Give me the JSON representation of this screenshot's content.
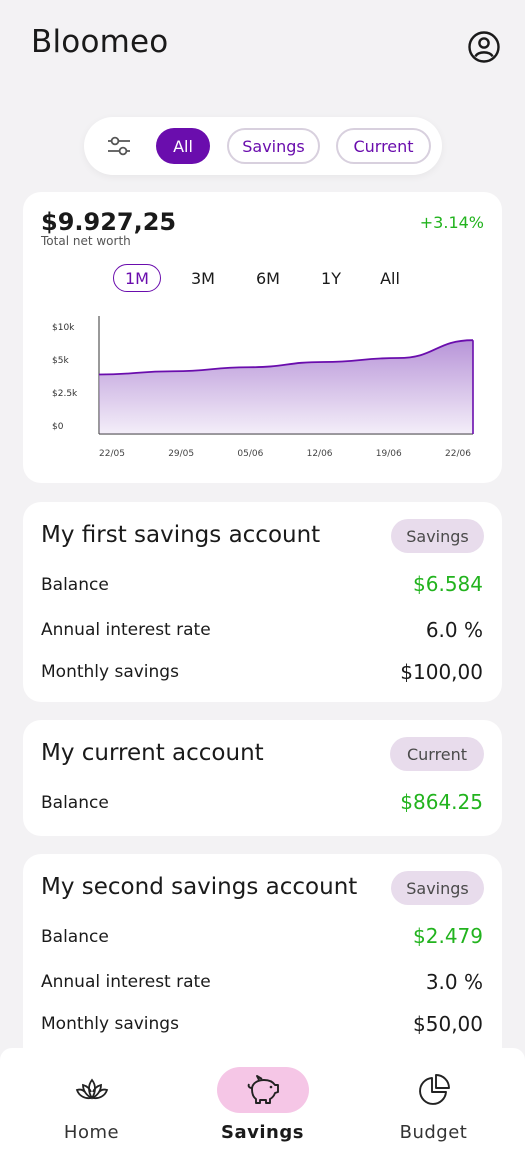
{
  "app": {
    "title": "Bloomeo"
  },
  "filters": {
    "all": "All",
    "savings": "Savings",
    "current": "Current",
    "selected": "All"
  },
  "networth": {
    "value": "$9.927,25",
    "label": "Total net worth",
    "change": "+3.14%",
    "ranges": [
      "1M",
      "3M",
      "6M",
      "1Y",
      "All"
    ],
    "selected_range": "1M"
  },
  "chart_data": {
    "type": "area",
    "x": [
      "22/05",
      "29/05",
      "05/06",
      "12/06",
      "19/06",
      "22/06"
    ],
    "x_ticks": [
      "22/05",
      "29/05",
      "05/06",
      "12/06",
      "19/06",
      "22/06"
    ],
    "y_ticks": [
      "$0",
      "$2.5k",
      "$5k",
      "$10k"
    ],
    "series": [
      {
        "values": [
          3900,
          4150,
          4450,
          4850,
          5300,
          8000
        ]
      }
    ],
    "line_color": "#6a0dad",
    "fill_color": "#b48fd6",
    "grid": false,
    "legend": "none"
  },
  "accounts": [
    {
      "name": "My first savings account",
      "badge": "Savings",
      "rows": [
        {
          "label": "Balance",
          "value": "$6.584",
          "green": true
        },
        {
          "label": "Annual interest rate",
          "value": "6.0 %",
          "green": false
        },
        {
          "label": "Monthly savings",
          "value": "$100,00",
          "green": false
        }
      ]
    },
    {
      "name": "My current account",
      "badge": "Current",
      "rows": [
        {
          "label": "Balance",
          "value": "$864.25",
          "green": true
        }
      ]
    },
    {
      "name": "My second savings account",
      "badge": "Savings",
      "rows": [
        {
          "label": "Balance",
          "value": "$2.479",
          "green": true
        },
        {
          "label": "Annual interest rate",
          "value": "3.0 %",
          "green": false
        },
        {
          "label": "Monthly savings",
          "value": "$50,00",
          "green": false
        }
      ]
    }
  ],
  "nav": {
    "items": [
      {
        "label": "Home",
        "icon": "lotus-icon"
      },
      {
        "label": "Savings",
        "icon": "piggy-bank-icon"
      },
      {
        "label": "Budget",
        "icon": "pie-chart-icon"
      }
    ],
    "active": "Savings"
  },
  "colors": {
    "accent": "#6a0dad",
    "positive": "#22b31e",
    "badge_bg": "#e8dcec",
    "active_nav_bg": "#f5c6e6"
  }
}
